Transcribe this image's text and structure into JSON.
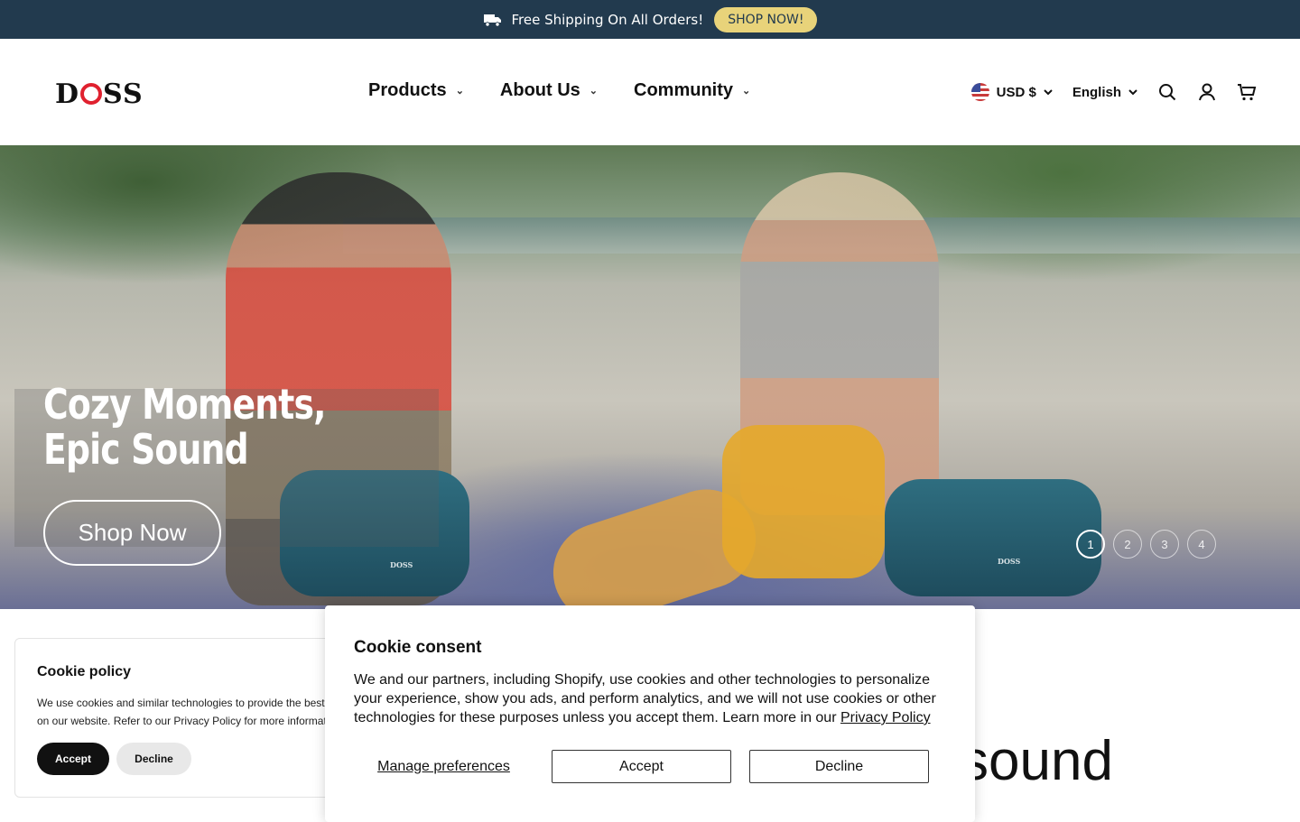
{
  "announcement": {
    "icon": "truck-icon",
    "text": "Free Shipping On All Orders!",
    "button": "SHOP NOW!"
  },
  "header": {
    "logo": {
      "pre": "D",
      "post": "SS"
    },
    "nav": [
      {
        "label": "Products"
      },
      {
        "label": "About Us"
      },
      {
        "label": "Community"
      }
    ],
    "currency": "USD $",
    "language": "English"
  },
  "hero": {
    "title": "Cozy Moments, Epic Sound",
    "button": "Shop Now",
    "speaker_brand": "DOSS",
    "slides": [
      "1",
      "2",
      "3",
      "4"
    ],
    "active_slide": 1
  },
  "below_hero": {
    "heading_fragment": "sound"
  },
  "cookie_policy": {
    "title": "Cookie policy",
    "line1": "We use cookies and similar technologies to provide the best",
    "line2": "on our website. Refer to our Privacy Policy for more informat",
    "accept": "Accept",
    "decline": "Decline"
  },
  "cookie_consent": {
    "title": "Cookie consent",
    "body": "We and our partners, including Shopify, use cookies and other technologies to personalize your experience, show you ads, and perform analytics, and we will not use cookies or other technologies for these purposes unless you accept them. Learn more in our",
    "privacy_link": "Privacy Policy",
    "manage": "Manage preferences",
    "accept": "Accept",
    "decline": "Decline"
  },
  "colors": {
    "announcement_bg": "#223a4e",
    "shop_btn_bg": "#e8d37a",
    "logo_accent": "#e0212f"
  }
}
